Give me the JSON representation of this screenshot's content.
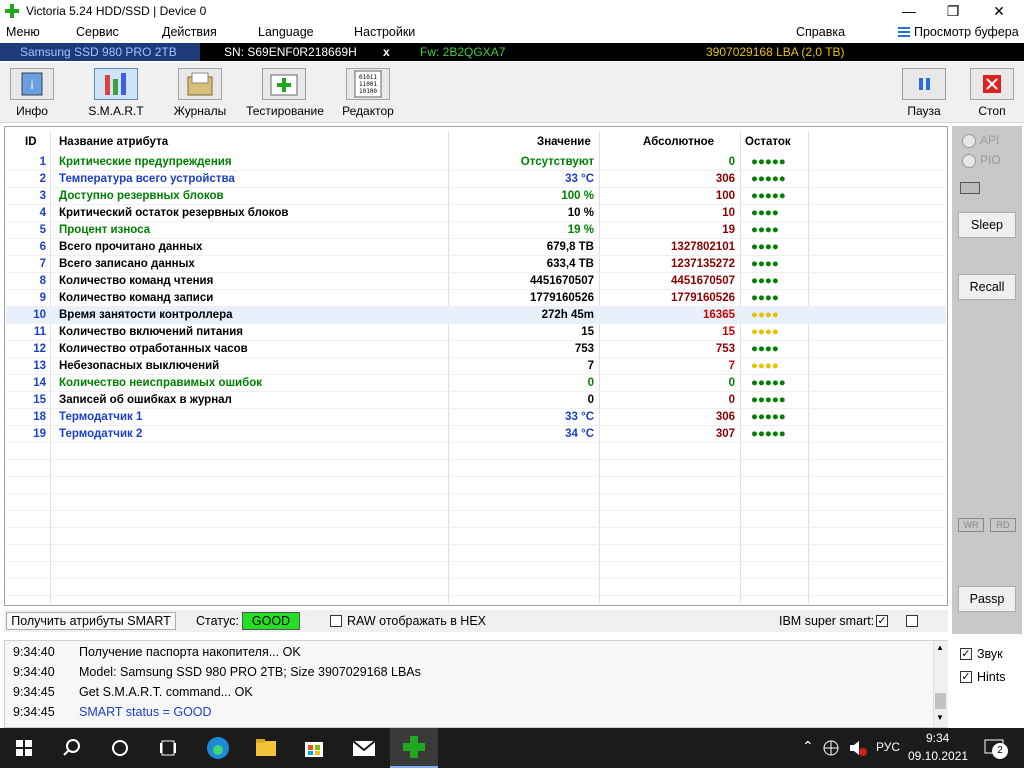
{
  "window": {
    "title": "Victoria 5.24 HDD/SSD | Device 0",
    "controls": [
      "—",
      "❐",
      "✕"
    ]
  },
  "menu": {
    "items": [
      "Меню",
      "Сервис",
      "Действия",
      "Language",
      "Настройки"
    ],
    "help": "Справка",
    "clipboard": "Просмотр буфера"
  },
  "device": {
    "model": "Samsung SSD 980 PRO 2TB",
    "serial": "SN: S69ENF0R218669H",
    "close": "x",
    "firmware": "Fw: 2B2QGXA7",
    "lba": "3907029168 LBA (2,0 TB)",
    "colors": {
      "model": "#9ec5ff",
      "serial": "#ffffff",
      "firmware": "#3ad13a",
      "lba": "#e6c200"
    }
  },
  "toolbar": {
    "buttons": [
      "Инфо",
      "S.M.A.R.T",
      "Журналы",
      "Тестирование",
      "Редактор"
    ],
    "pause": "Пауза",
    "stop": "Стоп"
  },
  "table": {
    "headers": {
      "id": "ID",
      "name": "Название атрибута",
      "value": "Значение",
      "raw": "Абсолютное",
      "remain": "Остаток"
    },
    "rows": [
      {
        "id": "1",
        "name": "Критические предупреждения",
        "value": "Отсутствуют",
        "raw": "0",
        "dots": "●●●●●",
        "color": "#008000",
        "raw_color": "#008000",
        "dot_color": "#008000"
      },
      {
        "id": "2",
        "name": "Температура всего устройства",
        "value": "33 °C",
        "raw": "306",
        "dots": "●●●●●",
        "color": "#1a3fc8",
        "raw_color": "#8b0000",
        "dot_color": "#008000"
      },
      {
        "id": "3",
        "name": "Доступно резервных блоков",
        "value": "100 %",
        "raw": "100",
        "dots": "●●●●●",
        "color": "#008000",
        "raw_color": "#8b0000",
        "dot_color": "#008000"
      },
      {
        "id": "4",
        "name": "Критический остаток резервных блоков",
        "value": "10 %",
        "raw": "10",
        "dots": "●●●●",
        "color": "#000000",
        "raw_color": "#8b0000",
        "dot_color": "#008000"
      },
      {
        "id": "5",
        "name": "Процент износа",
        "value": "19 %",
        "raw": "19",
        "dots": "●●●●",
        "color": "#008000",
        "raw_color": "#8b0000",
        "dot_color": "#008000"
      },
      {
        "id": "6",
        "name": "Всего прочитано данных",
        "value": "679,8 TB",
        "raw": "1327802101",
        "dots": "●●●●",
        "color": "#000000",
        "raw_color": "#8b0000",
        "dot_color": "#008000"
      },
      {
        "id": "7",
        "name": "Всего записано данных",
        "value": "633,4 TB",
        "raw": "1237135272",
        "dots": "●●●●",
        "color": "#000000",
        "raw_color": "#8b0000",
        "dot_color": "#008000"
      },
      {
        "id": "8",
        "name": "Количество команд чтения",
        "value": "4451670507",
        "raw": "4451670507",
        "dots": "●●●●",
        "color": "#000000",
        "raw_color": "#8b0000",
        "dot_color": "#008000"
      },
      {
        "id": "9",
        "name": "Количество команд записи",
        "value": "1779160526",
        "raw": "1779160526",
        "dots": "●●●●",
        "color": "#000000",
        "raw_color": "#8b0000",
        "dot_color": "#008000"
      },
      {
        "id": "10",
        "name": "Время занятости контроллера",
        "value": "272h 45m",
        "raw": "16365",
        "dots": "●●●●",
        "color": "#000000",
        "raw_color": "#cc0000",
        "dot_color": "#e6c200",
        "selected": true
      },
      {
        "id": "11",
        "name": "Количество включений питания",
        "value": "15",
        "raw": "15",
        "dots": "●●●●",
        "color": "#000000",
        "raw_color": "#cc0000",
        "dot_color": "#e6c200"
      },
      {
        "id": "12",
        "name": "Количество отработанных часов",
        "value": "753",
        "raw": "753",
        "dots": "●●●●",
        "color": "#000000",
        "raw_color": "#8b0000",
        "dot_color": "#008000"
      },
      {
        "id": "13",
        "name": "Небезопасных выключений",
        "value": "7",
        "raw": "7",
        "dots": "●●●●",
        "color": "#000000",
        "raw_color": "#cc0000",
        "dot_color": "#e6c200"
      },
      {
        "id": "14",
        "name": "Количество неисправимых ошибок",
        "value": "0",
        "raw": "0",
        "dots": "●●●●●",
        "color": "#008000",
        "raw_color": "#008000",
        "dot_color": "#008000"
      },
      {
        "id": "15",
        "name": "Записей об ошибках в журнал",
        "value": "0",
        "raw": "0",
        "dots": "●●●●●",
        "color": "#000000",
        "raw_color": "#8b0000",
        "dot_color": "#008000"
      },
      {
        "id": "18",
        "name": "Термодатчик 1",
        "value": "33 °C",
        "raw": "306",
        "dots": "●●●●●",
        "color": "#1a3fc8",
        "raw_color": "#8b0000",
        "dot_color": "#008000"
      },
      {
        "id": "19",
        "name": "Термодатчик 2",
        "value": "34 °C",
        "raw": "307",
        "dots": "●●●●●",
        "color": "#1a3fc8",
        "raw_color": "#8b0000",
        "dot_color": "#008000"
      }
    ]
  },
  "right_panel": {
    "api": "API",
    "pio": "PIO",
    "sleep": "Sleep",
    "recall": "Recall",
    "wr": "WR",
    "rd": "RD",
    "passp": "Passp"
  },
  "bottom": {
    "get_smart": "Получить атрибуты SMART",
    "status_label": "Статус:",
    "status_value": "GOOD",
    "raw_hex": "RAW отображать в HEX",
    "ibm": "IBM super smart:"
  },
  "log": [
    {
      "time": "9:34:40",
      "text": "Получение паспорта накопителя... OK",
      "color": "#000000"
    },
    {
      "time": "9:34:40",
      "text": "Model: Samsung SSD 980 PRO 2TB; Size 3907029168 LBAs",
      "color": "#000000"
    },
    {
      "time": "9:34:45",
      "text": "Get S.M.A.R.T. command... OK",
      "color": "#000000"
    },
    {
      "time": "9:34:45",
      "text": "SMART status = GOOD",
      "color": "#1a3fc8"
    }
  ],
  "side_options": {
    "sound": "Звук",
    "hints": "Hints"
  },
  "taskbar": {
    "lang": "РУС",
    "time": "9:34",
    "date": "09.10.2021",
    "notifications": "2"
  }
}
